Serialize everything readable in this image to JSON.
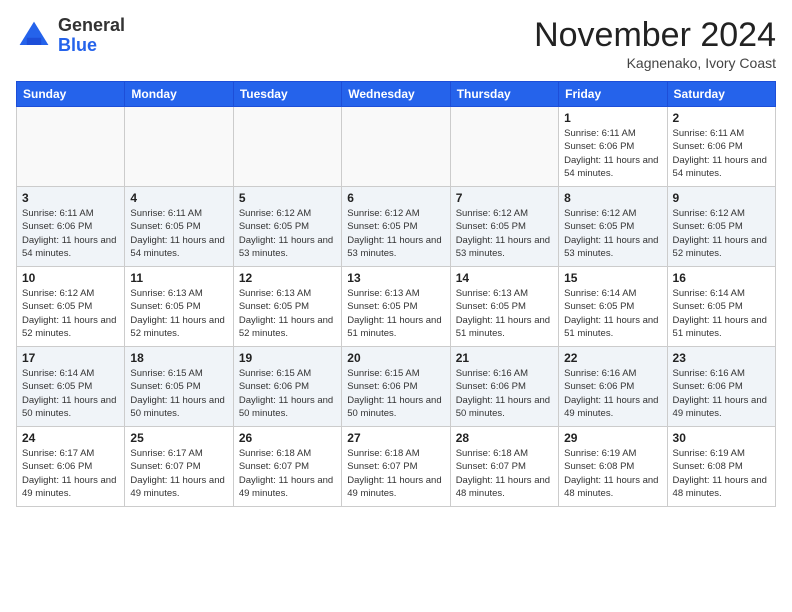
{
  "header": {
    "logo_line1": "General",
    "logo_line2": "Blue",
    "month_title": "November 2024",
    "location": "Kagnenako, Ivory Coast"
  },
  "weekdays": [
    "Sunday",
    "Monday",
    "Tuesday",
    "Wednesday",
    "Thursday",
    "Friday",
    "Saturday"
  ],
  "weeks": [
    [
      {
        "day": "",
        "info": ""
      },
      {
        "day": "",
        "info": ""
      },
      {
        "day": "",
        "info": ""
      },
      {
        "day": "",
        "info": ""
      },
      {
        "day": "",
        "info": ""
      },
      {
        "day": "1",
        "info": "Sunrise: 6:11 AM\nSunset: 6:06 PM\nDaylight: 11 hours\nand 54 minutes."
      },
      {
        "day": "2",
        "info": "Sunrise: 6:11 AM\nSunset: 6:06 PM\nDaylight: 11 hours\nand 54 minutes."
      }
    ],
    [
      {
        "day": "3",
        "info": "Sunrise: 6:11 AM\nSunset: 6:06 PM\nDaylight: 11 hours\nand 54 minutes."
      },
      {
        "day": "4",
        "info": "Sunrise: 6:11 AM\nSunset: 6:05 PM\nDaylight: 11 hours\nand 54 minutes."
      },
      {
        "day": "5",
        "info": "Sunrise: 6:12 AM\nSunset: 6:05 PM\nDaylight: 11 hours\nand 53 minutes."
      },
      {
        "day": "6",
        "info": "Sunrise: 6:12 AM\nSunset: 6:05 PM\nDaylight: 11 hours\nand 53 minutes."
      },
      {
        "day": "7",
        "info": "Sunrise: 6:12 AM\nSunset: 6:05 PM\nDaylight: 11 hours\nand 53 minutes."
      },
      {
        "day": "8",
        "info": "Sunrise: 6:12 AM\nSunset: 6:05 PM\nDaylight: 11 hours\nand 53 minutes."
      },
      {
        "day": "9",
        "info": "Sunrise: 6:12 AM\nSunset: 6:05 PM\nDaylight: 11 hours\nand 52 minutes."
      }
    ],
    [
      {
        "day": "10",
        "info": "Sunrise: 6:12 AM\nSunset: 6:05 PM\nDaylight: 11 hours\nand 52 minutes."
      },
      {
        "day": "11",
        "info": "Sunrise: 6:13 AM\nSunset: 6:05 PM\nDaylight: 11 hours\nand 52 minutes."
      },
      {
        "day": "12",
        "info": "Sunrise: 6:13 AM\nSunset: 6:05 PM\nDaylight: 11 hours\nand 52 minutes."
      },
      {
        "day": "13",
        "info": "Sunrise: 6:13 AM\nSunset: 6:05 PM\nDaylight: 11 hours\nand 51 minutes."
      },
      {
        "day": "14",
        "info": "Sunrise: 6:13 AM\nSunset: 6:05 PM\nDaylight: 11 hours\nand 51 minutes."
      },
      {
        "day": "15",
        "info": "Sunrise: 6:14 AM\nSunset: 6:05 PM\nDaylight: 11 hours\nand 51 minutes."
      },
      {
        "day": "16",
        "info": "Sunrise: 6:14 AM\nSunset: 6:05 PM\nDaylight: 11 hours\nand 51 minutes."
      }
    ],
    [
      {
        "day": "17",
        "info": "Sunrise: 6:14 AM\nSunset: 6:05 PM\nDaylight: 11 hours\nand 50 minutes."
      },
      {
        "day": "18",
        "info": "Sunrise: 6:15 AM\nSunset: 6:05 PM\nDaylight: 11 hours\nand 50 minutes."
      },
      {
        "day": "19",
        "info": "Sunrise: 6:15 AM\nSunset: 6:06 PM\nDaylight: 11 hours\nand 50 minutes."
      },
      {
        "day": "20",
        "info": "Sunrise: 6:15 AM\nSunset: 6:06 PM\nDaylight: 11 hours\nand 50 minutes."
      },
      {
        "day": "21",
        "info": "Sunrise: 6:16 AM\nSunset: 6:06 PM\nDaylight: 11 hours\nand 50 minutes."
      },
      {
        "day": "22",
        "info": "Sunrise: 6:16 AM\nSunset: 6:06 PM\nDaylight: 11 hours\nand 49 minutes."
      },
      {
        "day": "23",
        "info": "Sunrise: 6:16 AM\nSunset: 6:06 PM\nDaylight: 11 hours\nand 49 minutes."
      }
    ],
    [
      {
        "day": "24",
        "info": "Sunrise: 6:17 AM\nSunset: 6:06 PM\nDaylight: 11 hours\nand 49 minutes."
      },
      {
        "day": "25",
        "info": "Sunrise: 6:17 AM\nSunset: 6:07 PM\nDaylight: 11 hours\nand 49 minutes."
      },
      {
        "day": "26",
        "info": "Sunrise: 6:18 AM\nSunset: 6:07 PM\nDaylight: 11 hours\nand 49 minutes."
      },
      {
        "day": "27",
        "info": "Sunrise: 6:18 AM\nSunset: 6:07 PM\nDaylight: 11 hours\nand 49 minutes."
      },
      {
        "day": "28",
        "info": "Sunrise: 6:18 AM\nSunset: 6:07 PM\nDaylight: 11 hours\nand 48 minutes."
      },
      {
        "day": "29",
        "info": "Sunrise: 6:19 AM\nSunset: 6:08 PM\nDaylight: 11 hours\nand 48 minutes."
      },
      {
        "day": "30",
        "info": "Sunrise: 6:19 AM\nSunset: 6:08 PM\nDaylight: 11 hours\nand 48 minutes."
      }
    ]
  ]
}
